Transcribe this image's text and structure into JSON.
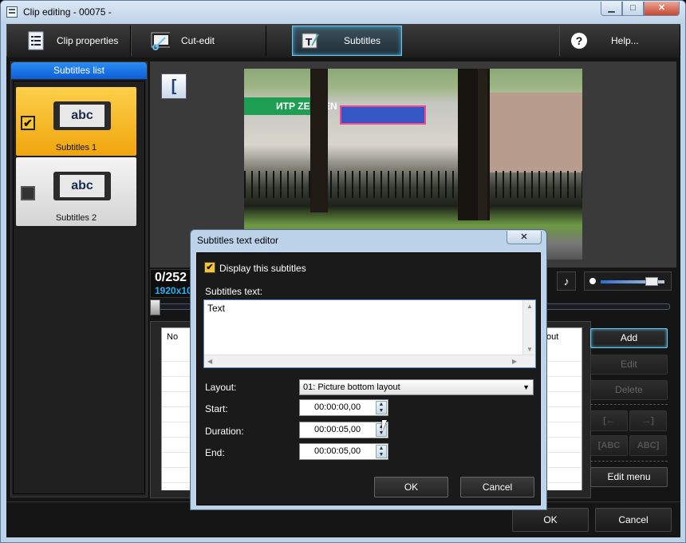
{
  "window": {
    "title": "Clip editing - 00075 -",
    "min_label": "▁",
    "max_label": "□",
    "close_label": "✕"
  },
  "tabs": [
    {
      "label": "Clip properties",
      "icon": "list-icon"
    },
    {
      "label": "Cut-edit",
      "icon": "scissors-icon"
    },
    {
      "label": "Subtitles",
      "icon": "subtitle-icon"
    },
    {
      "label": "Help...",
      "icon": "help-icon"
    }
  ],
  "help_glyph": "?",
  "subtitles_list": {
    "header": "Subtitles list",
    "items": [
      {
        "label": "Subtitles 1",
        "checked": true,
        "thumb": "abc"
      },
      {
        "label": "Subtitles 2",
        "checked": false,
        "thumb": "abc"
      }
    ]
  },
  "preview": {
    "bracket": "[",
    "counter": "0/252",
    "resolution": "1920x1080",
    "sign_text": "ИТР ZENDEN"
  },
  "table": {
    "col_no": "No",
    "col_out": "out"
  },
  "side_buttons": {
    "add": "Add",
    "edit": "Edit",
    "delete": "Delete",
    "prev": "[←",
    "next": "→]",
    "abc_l": "[ABC",
    "abc_r": "ABC]",
    "edit_menu": "Edit menu"
  },
  "footer": {
    "ok": "OK",
    "cancel": "Cancel"
  },
  "dialog": {
    "title": "Subtitles text editor",
    "display_label": "Display this subtitles",
    "display_checked": true,
    "text_label": "Subtitles text:",
    "text_value": "Text",
    "layout_label": "Layout:",
    "layout_value": "01: Picture bottom layout",
    "start_label": "Start:",
    "start_value": "00:00:00,00",
    "duration_label": "Duration:",
    "duration_value": "00:00:05,00",
    "end_label": "End:",
    "end_value": "00:00:05,00",
    "ok": "OK",
    "cancel": "Cancel"
  },
  "colors": {
    "accent": "#6ec6ee",
    "selected_item": "#f7c52e",
    "header_blue": "#0d5ed8"
  }
}
